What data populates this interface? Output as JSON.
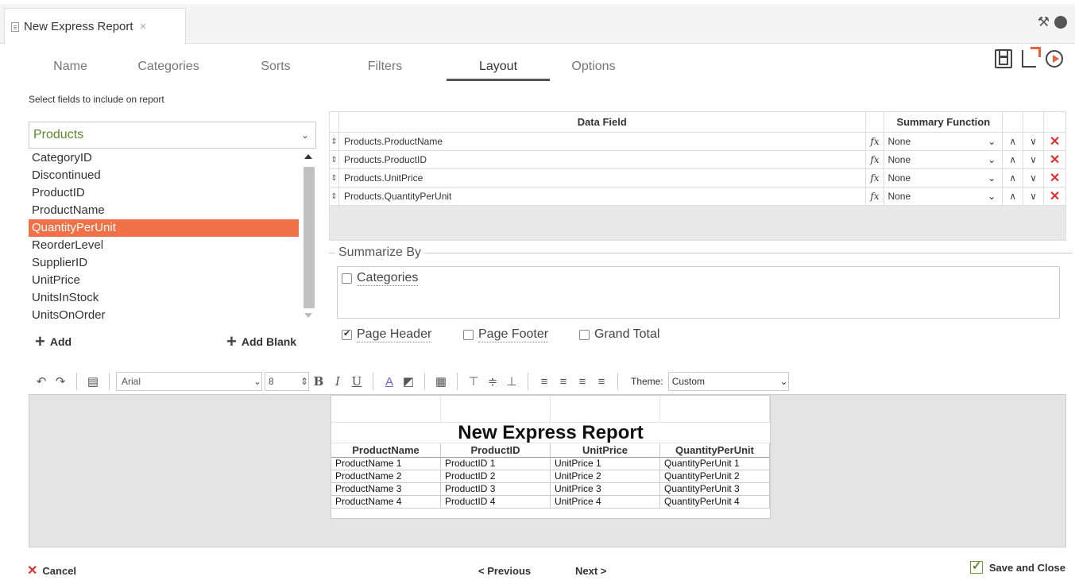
{
  "window": {
    "tab_title": "New Express Report",
    "tab_close": "×",
    "tools_icon": "⚒",
    "help_icon": "?"
  },
  "wizard_tabs": [
    {
      "label": "Name",
      "active": false
    },
    {
      "label": "Categories",
      "active": false
    },
    {
      "label": "Sorts",
      "active": false
    },
    {
      "label": "Filters",
      "active": false
    },
    {
      "label": "Layout",
      "active": true
    },
    {
      "label": "Options",
      "active": false
    }
  ],
  "fields_panel": {
    "instruction": "Select fields to include on report",
    "table": "Products",
    "fields": [
      "CategoryID",
      "Discontinued",
      "ProductID",
      "ProductName",
      "QuantityPerUnit",
      "ReorderLevel",
      "SupplierID",
      "UnitPrice",
      "UnitsInStock",
      "UnitsOnOrder"
    ],
    "selected_field": "QuantityPerUnit",
    "add_label": "Add",
    "add_blank_label": "Add Blank"
  },
  "data_grid": {
    "col_field": "Data Field",
    "col_function": "Summary Function",
    "rows": [
      {
        "field": "Products.ProductName",
        "fx": "fx",
        "func": "None"
      },
      {
        "field": "Products.ProductID",
        "fx": "fx",
        "func": "None"
      },
      {
        "field": "Products.UnitPrice",
        "fx": "fx",
        "func": "None"
      },
      {
        "field": "Products.QuantityPerUnit",
        "fx": "fx",
        "func": "None"
      }
    ]
  },
  "summarize": {
    "legend": "Summarize By",
    "categories_label": "Categories",
    "categories_checked": false
  },
  "report_options": {
    "page_header": "Page Header",
    "page_header_checked": true,
    "page_footer": "Page Footer",
    "page_footer_checked": false,
    "grand_total": "Grand Total",
    "grand_total_checked": false
  },
  "toolbar": {
    "font": "Arial",
    "size": "8",
    "bold": "B",
    "italic": "I",
    "underline": "U",
    "font_color": "A",
    "theme_label": "Theme:",
    "theme": "Custom"
  },
  "preview": {
    "title": "New Express Report",
    "headers": [
      "ProductName",
      "ProductID",
      "UnitPrice",
      "QuantityPerUnit"
    ],
    "rows": [
      [
        "ProductName 1",
        "ProductID 1",
        "UnitPrice 1",
        "QuantityPerUnit 1"
      ],
      [
        "ProductName 2",
        "ProductID 2",
        "UnitPrice 2",
        "QuantityPerUnit 2"
      ],
      [
        "ProductName 3",
        "ProductID 3",
        "UnitPrice 3",
        "QuantityPerUnit 3"
      ],
      [
        "ProductName 4",
        "ProductID 4",
        "UnitPrice 4",
        "QuantityPerUnit 4"
      ]
    ]
  },
  "footer": {
    "cancel": "Cancel",
    "previous": "< Previous",
    "next": "Next >",
    "save_close": "Save and Close"
  },
  "colors": {
    "accent": "#f07048",
    "green": "#5c8a2a",
    "delete_red": "#dd3333"
  }
}
